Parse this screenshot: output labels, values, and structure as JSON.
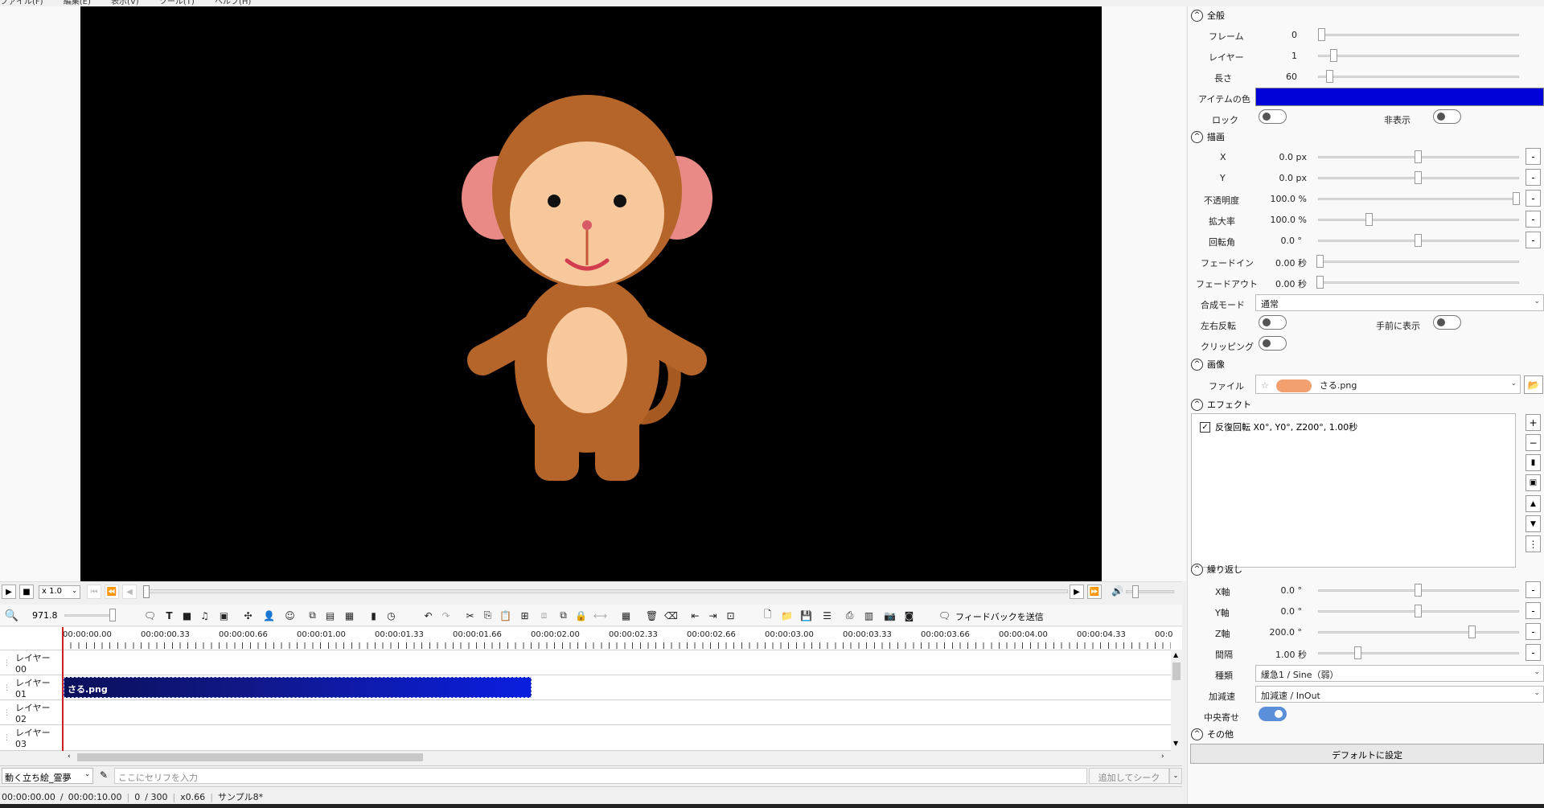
{
  "menu": [
    "ファイル(F)",
    "編集(E)",
    "表示(V)",
    "ツール(T)",
    "ヘルプ(H)"
  ],
  "playback": {
    "speed": "x 1.0"
  },
  "toolbar": {
    "zoom": "971.8",
    "feedback": "フィードバックを送信"
  },
  "ruler": {
    "labels": [
      "00:00:00.00",
      "00:00:00.33",
      "00:00:00.66",
      "00:00:01.00",
      "00:00:01.33",
      "00:00:01.66",
      "00:00:02.00",
      "00:00:02.33",
      "00:00:02.66",
      "00:00:03.00",
      "00:00:03.33",
      "00:00:03.66",
      "00:00:04.00",
      "00:00:04.33",
      "00:0"
    ]
  },
  "timeline": {
    "layers": [
      "レイヤー 00",
      "レイヤー 01",
      "レイヤー 02",
      "レイヤー 03"
    ],
    "clip": "さる.png"
  },
  "serif": {
    "character": "動く立ち絵_霊夢",
    "placeholder": "ここにセリフを入力",
    "add_button": "追加してシーク"
  },
  "status": {
    "time": "00:00:00.00",
    "sep": "/",
    "total": "00:00:10.00",
    "frame": "0",
    "frames": "/ 300",
    "zoom": "x0.66",
    "project": "サンプル8*"
  },
  "props": {
    "general": {
      "title": "全般",
      "frame_label": "フレーム",
      "frame_value": "0",
      "layer_label": "レイヤー",
      "layer_value": "1",
      "length_label": "長さ",
      "length_value": "60",
      "color_label": "アイテムの色",
      "color": "#0000d8",
      "lock_label": "ロック",
      "hide_label": "非表示"
    },
    "draw": {
      "title": "描画",
      "x_label": "X",
      "x_value": "0.0 px",
      "y_label": "Y",
      "y_value": "0.0 px",
      "opacity_label": "不透明度",
      "opacity_value": "100.0 %",
      "scale_label": "拡大率",
      "scale_value": "100.0 %",
      "rotate_label": "回転角",
      "rotate_value": "0.0 °",
      "fadein_label": "フェードイン",
      "fadein_value": "0.00 秒",
      "fadeout_label": "フェードアウト",
      "fadeout_value": "0.00 秒",
      "blend_label": "合成モード",
      "blend_value": "通常",
      "flip_label": "左右反転",
      "front_label": "手前に表示",
      "clip_label": "クリッピング"
    },
    "image": {
      "title": "画像",
      "file_label": "ファイル",
      "file_value": "さる.png"
    },
    "effect": {
      "title": "エフェクト",
      "item": "反復回転 X0°, Y0°, Z200°, 1.00秒"
    },
    "repeat": {
      "title": "繰り返し",
      "xaxis_label": "X軸",
      "xaxis_value": "0.0 °",
      "yaxis_label": "Y軸",
      "yaxis_value": "0.0 °",
      "zaxis_label": "Z軸",
      "zaxis_value": "200.0 °",
      "interval_label": "間隔",
      "interval_value": "1.00 秒",
      "kind_label": "種類",
      "kind_value": "緩急1 / Sine（弱）",
      "ease_label": "加減速",
      "ease_value": "加減速 / InOut",
      "center_label": "中央寄せ"
    },
    "other": {
      "title": "その他"
    },
    "default_button": "デフォルトに設定"
  }
}
